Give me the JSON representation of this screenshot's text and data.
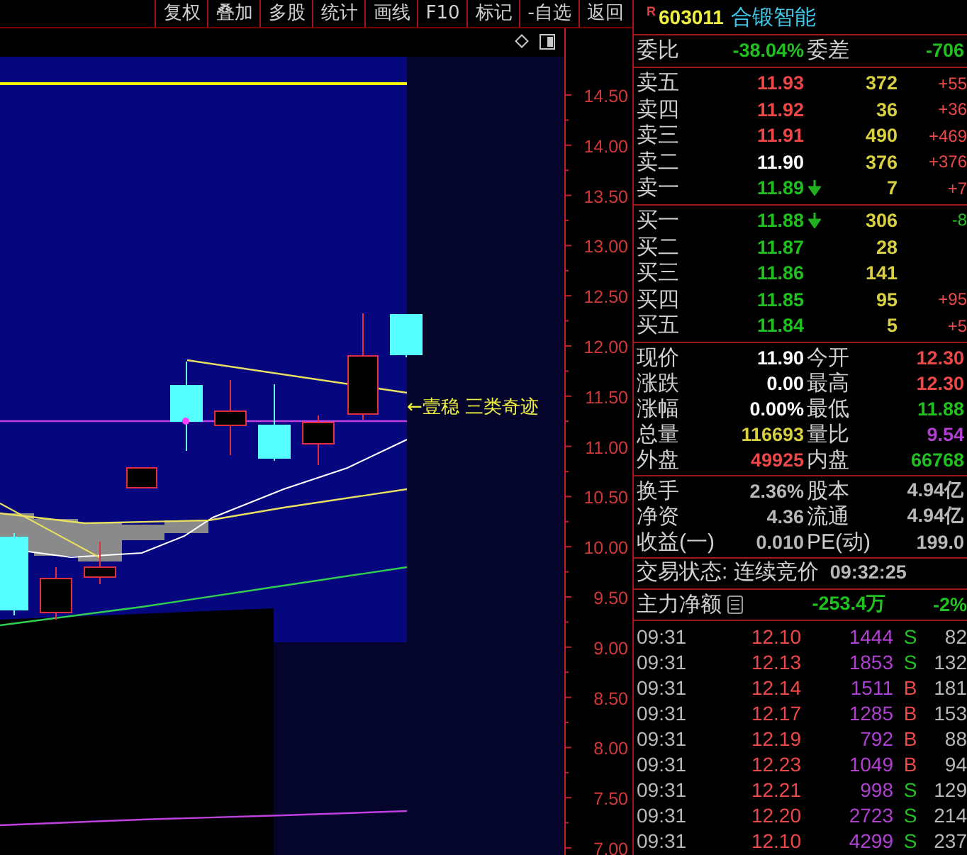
{
  "toolbar": [
    "复权",
    "叠加",
    "多股",
    "统计",
    "画线",
    "F10",
    "标记",
    "-自选",
    "返回"
  ],
  "chart": {
    "annotation": "←壹稳 三类奇迹",
    "price_axis": [
      "14.50",
      "14.00",
      "13.50",
      "13.00",
      "12.50",
      "12.00",
      "11.50",
      "11.00",
      "10.50",
      "10.00",
      "9.50",
      "9.00",
      "8.50",
      "8.00",
      "7.50",
      "7.00"
    ]
  },
  "quote": {
    "badge": "R",
    "code": "603011",
    "name": "合锻智能"
  },
  "order_ratio": {
    "label": "委比",
    "value": "-38.04%",
    "diff_label": "委差",
    "diff": "-706"
  },
  "asks": [
    {
      "label": "卖五",
      "price": "11.93",
      "color": "#ec4848",
      "falling": false,
      "volume": "372",
      "change": {
        "value": "+55",
        "color": "#ec4848"
      }
    },
    {
      "label": "卖四",
      "price": "11.92",
      "color": "#ec4848",
      "falling": false,
      "volume": "36",
      "change": {
        "value": "+36",
        "color": "#ec4848"
      }
    },
    {
      "label": "卖三",
      "price": "11.91",
      "color": "#ec4848",
      "falling": false,
      "volume": "490",
      "change": {
        "value": "+469",
        "color": "#ec4848"
      }
    },
    {
      "label": "卖二",
      "price": "11.90",
      "color": "#ffffff",
      "falling": false,
      "volume": "376",
      "change": {
        "value": "+376",
        "color": "#ec4848"
      }
    },
    {
      "label": "卖一",
      "price": "11.89",
      "color": "#20c020",
      "falling": true,
      "volume": "7",
      "change": {
        "value": "+7",
        "color": "#ec4848"
      }
    }
  ],
  "bids": [
    {
      "label": "买一",
      "price": "11.88",
      "color": "#20c020",
      "falling": true,
      "volume": "306",
      "change": {
        "value": "-8",
        "color": "#20c020"
      }
    },
    {
      "label": "买二",
      "price": "11.87",
      "color": "#20c020",
      "falling": false,
      "volume": "28"
    },
    {
      "label": "买三",
      "price": "11.86",
      "color": "#20c020",
      "falling": false,
      "volume": "141"
    },
    {
      "label": "买四",
      "price": "11.85",
      "color": "#20c020",
      "falling": false,
      "volume": "95",
      "change": {
        "value": "+95",
        "color": "#ec4848"
      }
    },
    {
      "label": "买五",
      "price": "11.84",
      "color": "#20c020",
      "falling": false,
      "volume": "5",
      "change": {
        "value": "+5",
        "color": "#ec4848"
      }
    }
  ],
  "stats": [
    [
      {
        "label": "现价",
        "value": "11.90",
        "color": "#ffffff"
      },
      {
        "label": "今开",
        "value": "12.30",
        "color": "#ec4848"
      }
    ],
    [
      {
        "label": "涨跌",
        "value": "0.00",
        "color": "#ffffff"
      },
      {
        "label": "最高",
        "value": "12.30",
        "color": "#ec4848"
      }
    ],
    [
      {
        "label": "涨幅",
        "value": "0.00%",
        "color": "#ffffff"
      },
      {
        "label": "最低",
        "value": "11.88",
        "color": "#20c020"
      }
    ],
    [
      {
        "label": "总量",
        "value": "116693",
        "color": "#d8d040"
      },
      {
        "label": "量比",
        "value": "9.54",
        "color": "#b040d0"
      }
    ],
    [
      {
        "label": "外盘",
        "value": "49925",
        "color": "#ec4848"
      },
      {
        "label": "内盘",
        "value": "66768",
        "color": "#20c020"
      }
    ]
  ],
  "fundamentals": [
    [
      {
        "label": "换手",
        "value": "2.36%"
      },
      {
        "label": "股本",
        "value": "4.94亿"
      }
    ],
    [
      {
        "label": "净资",
        "value": "4.36"
      },
      {
        "label": "流通",
        "value": "4.94亿"
      }
    ],
    [
      {
        "label": "收益(一)",
        "value": "0.010"
      },
      {
        "label": "PE(动)",
        "value": "199.0"
      }
    ]
  ],
  "trade_status": {
    "label": "交易状态: 连续竞价",
    "time": "09:32:25"
  },
  "main_flow": {
    "label": "主力净额",
    "amount": "-253.4万",
    "percent": "-2%"
  },
  "ticks": [
    {
      "time": "09:31",
      "price": "12.10",
      "volume": "1444",
      "side": "S",
      "kind": "sell",
      "count": "82"
    },
    {
      "time": "09:31",
      "price": "12.13",
      "volume": "1853",
      "side": "S",
      "kind": "sell",
      "count": "132"
    },
    {
      "time": "09:31",
      "price": "12.14",
      "volume": "1511",
      "side": "B",
      "kind": "buy",
      "count": "181"
    },
    {
      "time": "09:31",
      "price": "12.17",
      "volume": "1285",
      "side": "B",
      "kind": "buy",
      "count": "153"
    },
    {
      "time": "09:31",
      "price": "12.19",
      "volume": "792",
      "side": "B",
      "kind": "buy",
      "count": "88"
    },
    {
      "time": "09:31",
      "price": "12.23",
      "volume": "1049",
      "side": "B",
      "kind": "buy",
      "count": "94"
    },
    {
      "time": "09:31",
      "price": "12.21",
      "volume": "998",
      "side": "S",
      "kind": "sell",
      "count": "129"
    },
    {
      "time": "09:31",
      "price": "12.20",
      "volume": "2723",
      "side": "S",
      "kind": "sell",
      "count": "214"
    },
    {
      "time": "09:31",
      "price": "12.10",
      "volume": "4299",
      "side": "S",
      "kind": "sell",
      "count": "237"
    }
  ]
}
